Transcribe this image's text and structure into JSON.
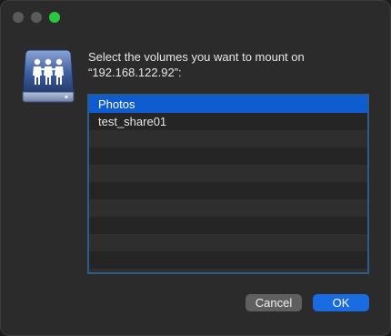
{
  "dialog": {
    "prompt_line1": "Select the volumes you want to mount on",
    "prompt_line2": "“192.168.122.92”:",
    "icon": "shared-server-icon"
  },
  "volumes": {
    "items": [
      "Photos",
      "test_share01"
    ],
    "selected_index": 0
  },
  "buttons": {
    "cancel_label": "Cancel",
    "ok_label": "OK"
  },
  "colors": {
    "selection": "#0f5bd0",
    "default_button": "#1a6ae0",
    "list_border": "#2a5d8a"
  }
}
